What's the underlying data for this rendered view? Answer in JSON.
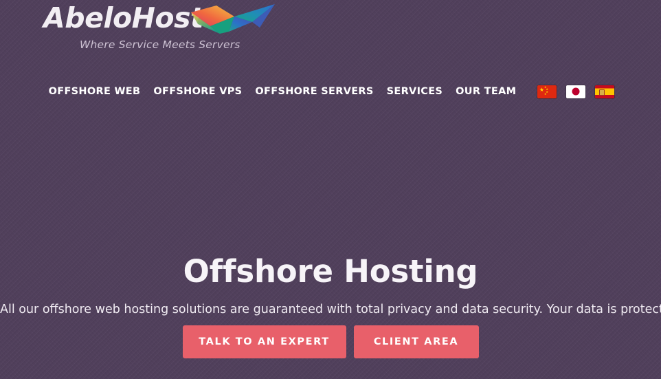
{
  "site": {
    "background_color": "#51405c",
    "accent_color": "#e8606a"
  },
  "logo": {
    "wordmark": "AbeloHost",
    "tagline": "Where Service Meets Servers",
    "mark_icon": "abelohost-butterfly-mark"
  },
  "nav": {
    "items": [
      {
        "label": "OFFSHORE WEB"
      },
      {
        "label": "OFFSHORE VPS"
      },
      {
        "label": "OFFSHORE SERVERS"
      },
      {
        "label": "SERVICES"
      },
      {
        "label": "OUR TEAM"
      }
    ],
    "flags": [
      {
        "name": "china-flag",
        "country": "China"
      },
      {
        "name": "japan-flag",
        "country": "Japan"
      },
      {
        "name": "spain-flag",
        "country": "Spain"
      }
    ]
  },
  "hero": {
    "title": "Offshore Hosting",
    "subtitle": "All our offshore web hosting solutions are guaranteed with total privacy and data security. Your data is protected with us.",
    "primary_cta": "TALK TO AN EXPERT",
    "secondary_cta": "CLIENT AREA"
  }
}
